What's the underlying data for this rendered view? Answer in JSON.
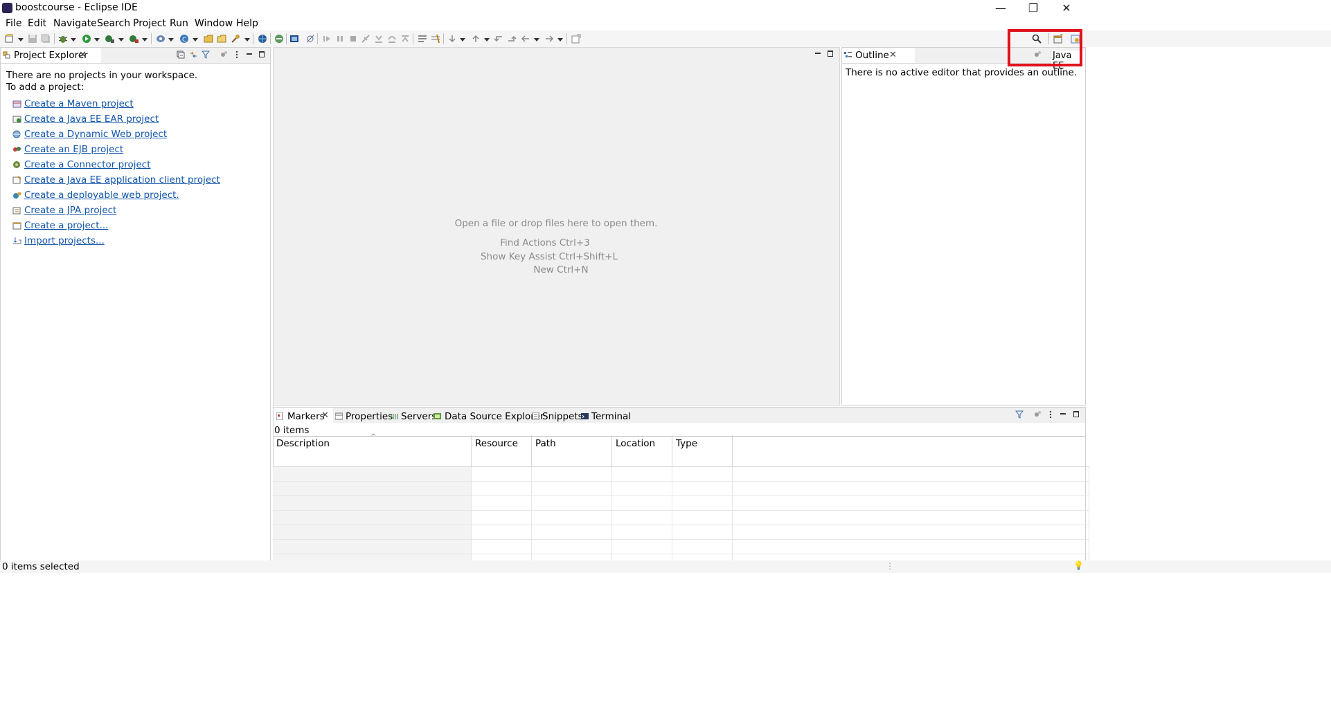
{
  "window": {
    "title": "boostcourse - Eclipse IDE",
    "minimize": "—",
    "restore": "❐",
    "close": "✕"
  },
  "menu": [
    "File",
    "Edit",
    "Navigate",
    "Search",
    "Project",
    "Run",
    "Window",
    "Help"
  ],
  "perspective": {
    "label": "Java EE"
  },
  "project_explorer": {
    "tab_label": "Project Explorer",
    "message_line1": "There are no projects in your workspace.",
    "message_line2": "To add a project:",
    "links": [
      "Create a Maven project",
      "Create a Java EE EAR project",
      "Create a Dynamic Web project",
      "Create an EJB project",
      "Create a Connector project",
      "Create a Java EE application client project",
      "Create a deployable web project.",
      "Create a JPA project",
      "Create a project...",
      "Import projects..."
    ]
  },
  "editor": {
    "open_hint": "Open a file or drop files here to open them.",
    "find_actions": "Find Actions Ctrl+3",
    "key_assist": "Show Key Assist Ctrl+Shift+L",
    "new_hint": "New Ctrl+N"
  },
  "outline": {
    "tab_label": "Outline",
    "message": "There is no active editor that provides an outline."
  },
  "bottom_panel": {
    "tabs": [
      "Markers",
      "Properties",
      "Servers",
      "Data Source Explorer",
      "Snippets",
      "Terminal"
    ],
    "count": "0 items",
    "columns": [
      "Description",
      "Resource",
      "Path",
      "Location",
      "Type"
    ]
  },
  "status": {
    "text": "0 items selected"
  },
  "colors": {
    "link": "#1155aa",
    "highlight": "#e0121c",
    "hint_text": "#8a8a8a"
  }
}
